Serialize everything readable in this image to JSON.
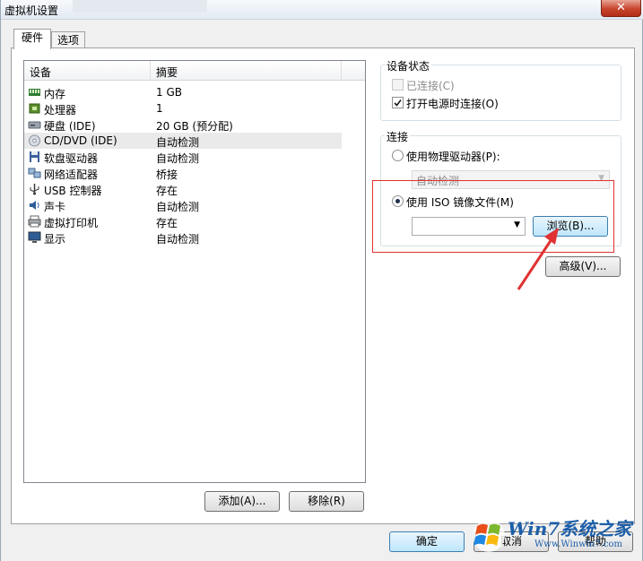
{
  "window": {
    "title": "虚拟机设置"
  },
  "tabs": [
    {
      "label": "硬件"
    },
    {
      "label": "选项"
    }
  ],
  "device_list": {
    "headers": {
      "device": "设备",
      "summary": "摘要"
    },
    "rows": [
      {
        "name": "内存",
        "summary": "1 GB",
        "icon": "memory-icon"
      },
      {
        "name": "处理器",
        "summary": "1",
        "icon": "processor-icon"
      },
      {
        "name": "硬盘 (IDE)",
        "summary": "20 GB (预分配)",
        "icon": "hard-disk-icon"
      },
      {
        "name": "CD/DVD (IDE)",
        "summary": "自动检测",
        "icon": "cd-dvd-icon"
      },
      {
        "name": "软盘驱动器",
        "summary": "自动检测",
        "icon": "floppy-icon"
      },
      {
        "name": "网络适配器",
        "summary": "桥接",
        "icon": "network-adapter-icon"
      },
      {
        "name": "USB 控制器",
        "summary": "存在",
        "icon": "usb-icon"
      },
      {
        "name": "声卡",
        "summary": "自动检测",
        "icon": "sound-card-icon"
      },
      {
        "name": "虚拟打印机",
        "summary": "存在",
        "icon": "printer-icon"
      },
      {
        "name": "显示",
        "summary": "自动检测",
        "icon": "display-icon"
      }
    ],
    "selected_index": 3
  },
  "list_buttons": {
    "add": "添加(A)...",
    "remove": "移除(R)"
  },
  "device_status": {
    "title": "设备状态",
    "connected": {
      "label": "已连接(C)",
      "checked": false,
      "enabled": false
    },
    "connect_on_power": {
      "label": "打开电源时连接(O)",
      "checked": true
    }
  },
  "connection": {
    "title": "连接",
    "physical": {
      "label": "使用物理驱动器(P):",
      "selected": false,
      "value": "自动检测"
    },
    "iso": {
      "label": "使用 ISO 镜像文件(M)",
      "selected": true,
      "value": ""
    },
    "browse": "浏览(B)...",
    "advanced": "高级(V)..."
  },
  "footer": {
    "ok": "确定",
    "cancel": "取消",
    "help": "帮助"
  },
  "watermark": {
    "brand": "Win7系统之家",
    "url": "Www.Winwin7.com"
  },
  "colors": {
    "annotation": "#e03232",
    "accent": "#3c7fb1"
  }
}
